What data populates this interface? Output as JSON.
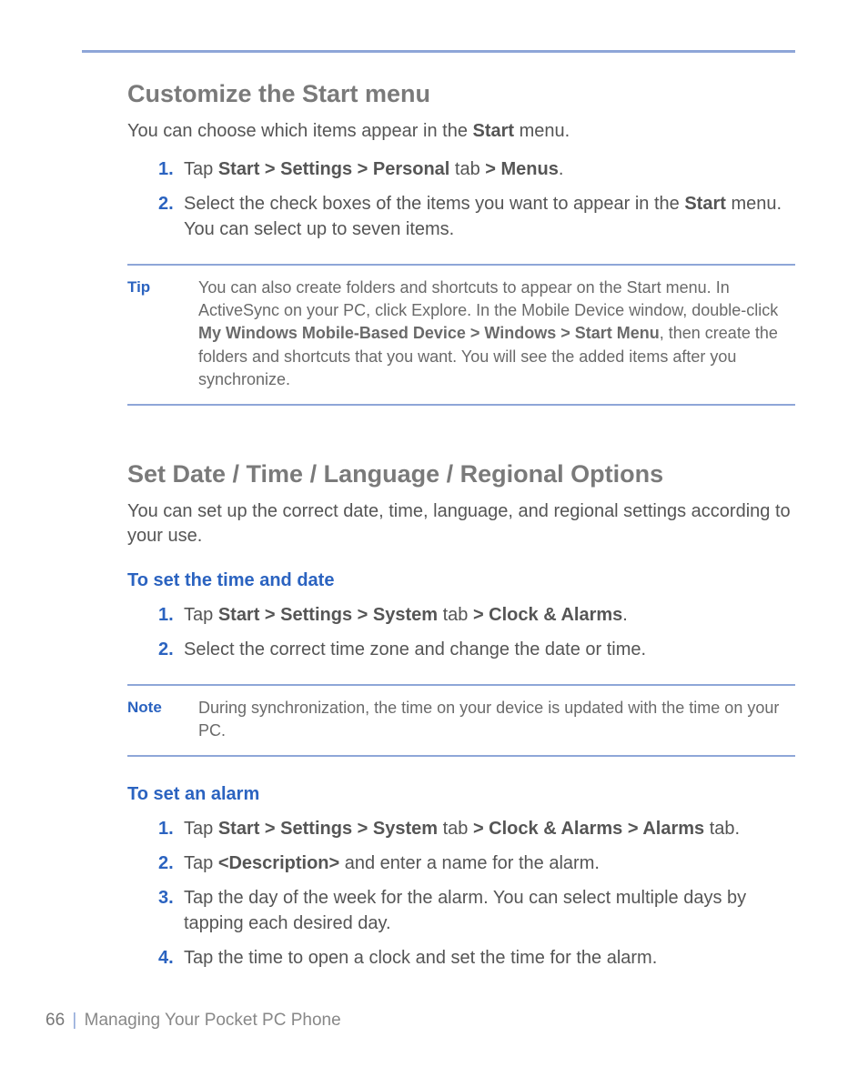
{
  "section1": {
    "heading": "Customize the Start menu",
    "intro_pre": "You can choose which items appear in the ",
    "intro_bold": "Start",
    "intro_post": " menu.",
    "steps": {
      "s1": {
        "num": "1.",
        "t1": "Tap ",
        "b1": "Start > Settings > Personal ",
        "t2": "tab",
        "b2": " > Menus",
        "t3": "."
      },
      "s2": {
        "num": "2.",
        "t1": "Select the check boxes of the items you want to appear in the ",
        "b1": "Start",
        "t2": " menu. You can select up to seven items."
      }
    },
    "tip": {
      "label": "Tip",
      "t1": "You can also create folders and shortcuts to appear on the Start menu. In ActiveSync on your PC, click Explore. In the Mobile Device window, double-click ",
      "b1": "My Windows Mobile-Based Device > Windows > Start Menu",
      "t2": ", then create the folders and shortcuts that you want. You will see the added items after you synchronize."
    }
  },
  "section2": {
    "heading": "Set Date / Time / Language / Regional Options",
    "intro": "You can set up the correct date, time, language, and regional settings according to your use.",
    "sub1": {
      "heading": "To set the time and date",
      "steps": {
        "s1": {
          "num": "1.",
          "t1": "Tap ",
          "b1": "Start > Settings > System ",
          "t2": "tab",
          "b2": " > Clock & Alarms",
          "t3": "."
        },
        "s2": {
          "num": "2.",
          "t1": "Select the correct time zone and change the date or time."
        }
      }
    },
    "note": {
      "label": "Note",
      "body": "During synchronization, the time on your device is updated with the time on your PC."
    },
    "sub2": {
      "heading": "To set an alarm",
      "steps": {
        "s1": {
          "num": "1.",
          "t1": "Tap ",
          "b1": "Start > Settings > System ",
          "t2": "tab",
          "b2": " > Clock & Alarms > Alarms ",
          "t3": "tab."
        },
        "s2": {
          "num": "2.",
          "t1": "Tap ",
          "b1": "<Description>",
          "t2": " and enter a name for the alarm."
        },
        "s3": {
          "num": "3.",
          "t1": "Tap the day of the week for the alarm. You can select multiple days by tapping each desired day."
        },
        "s4": {
          "num": "4.",
          "t1": "Tap the time to open a clock and set the time for the alarm."
        }
      }
    }
  },
  "footer": {
    "page": "66",
    "sep": "|",
    "title": "Managing Your Pocket PC Phone"
  }
}
